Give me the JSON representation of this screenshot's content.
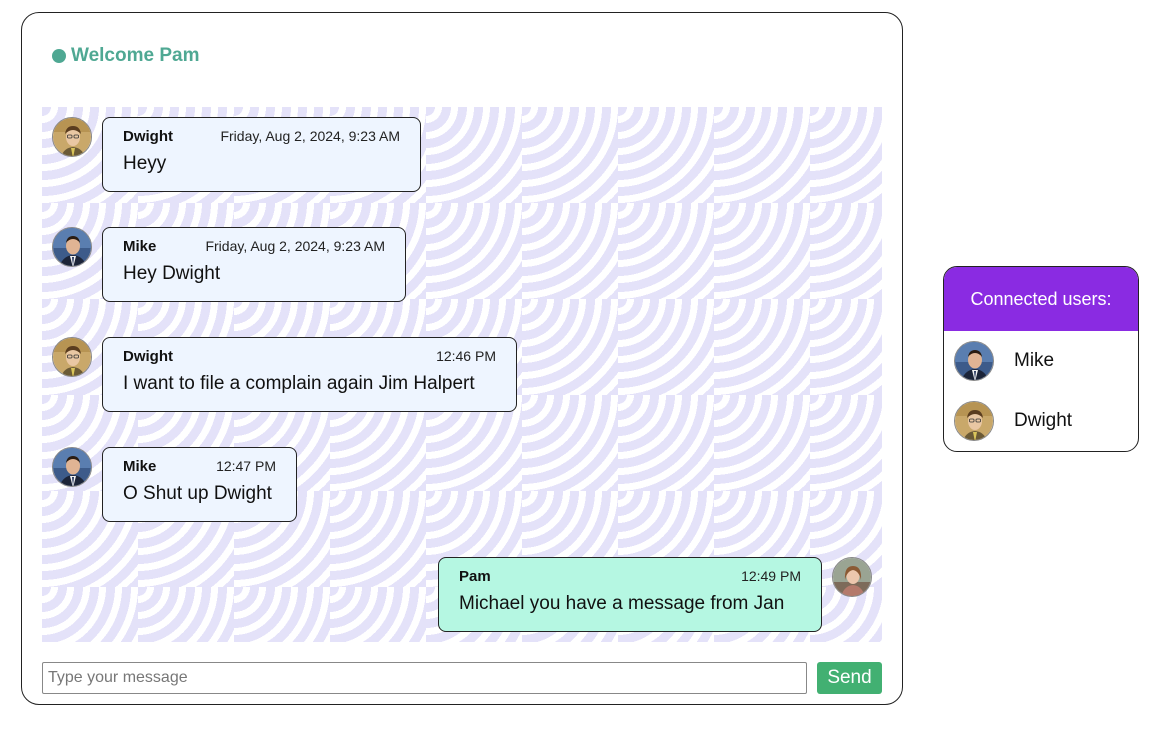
{
  "header": {
    "welcome": "Welcome Pam"
  },
  "messages": [
    {
      "sender": "Dwight",
      "time": "Friday, Aug 2, 2024, 9:23 AM",
      "text": "Heyy",
      "avatar": "dwight-avatar-icon"
    },
    {
      "sender": "Mike",
      "time": "Friday, Aug 2, 2024, 9:23 AM",
      "text": "Hey Dwight",
      "avatar": "mike-avatar-icon"
    },
    {
      "sender": "Dwight",
      "time": "12:46 PM",
      "text": "I want to file a complain again Jim Halpert",
      "avatar": "dwight-avatar-icon"
    },
    {
      "sender": "Mike",
      "time": "12:47 PM",
      "text": "O Shut up Dwight",
      "avatar": "mike-avatar-icon"
    },
    {
      "sender": "Pam",
      "time": "12:49 PM",
      "text": "Michael you have a message from Jan",
      "avatar": "pam-avatar-icon"
    }
  ],
  "composer": {
    "placeholder": "Type your message",
    "send_label": "Send"
  },
  "users_panel": {
    "title": "Connected users:",
    "users": [
      {
        "name": "Mike",
        "avatar": "mike-avatar-icon"
      },
      {
        "name": "Dwight",
        "avatar": "dwight-avatar-icon"
      }
    ]
  },
  "colors": {
    "accent_green": "#4fa893",
    "send_button": "#42b072",
    "panel_header": "#8a2be2",
    "bubble_other": "#eef5ff",
    "bubble_own": "#b5f7e2"
  }
}
